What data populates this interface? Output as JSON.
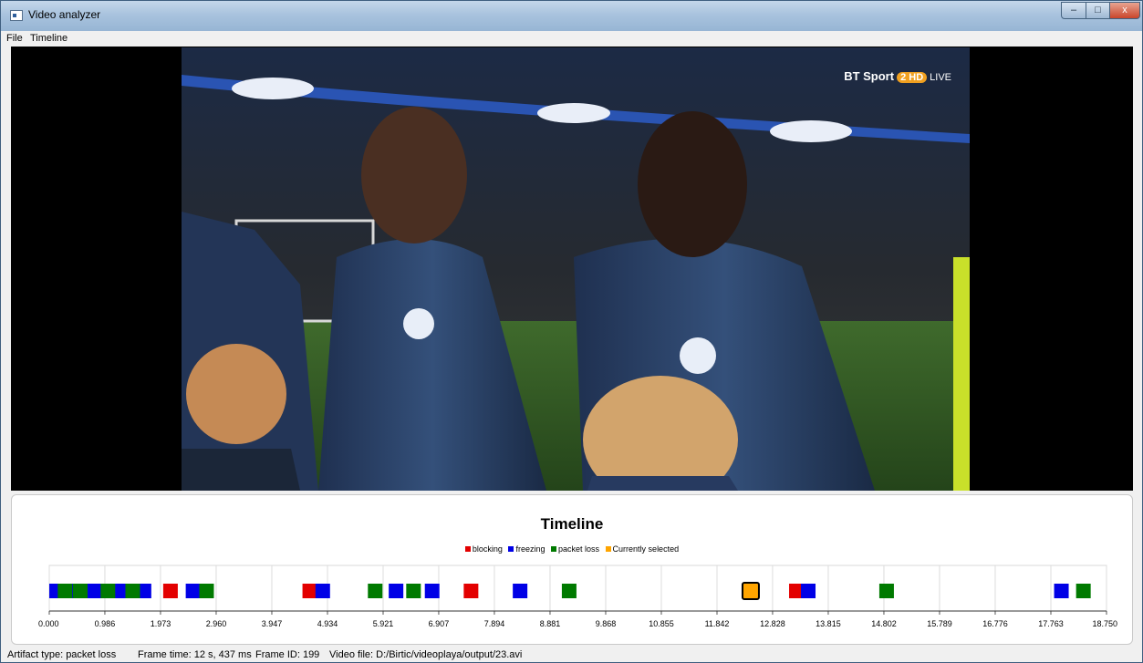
{
  "window": {
    "title": "Video analyzer",
    "minimize_glyph": "–",
    "maximize_glyph": "□",
    "close_glyph": "x"
  },
  "menu": {
    "file": "File",
    "timeline": "Timeline"
  },
  "video": {
    "logo_brand": "BT Sport",
    "logo_channel": "2 HD",
    "logo_live": "LIVE"
  },
  "timeline": {
    "title": "Timeline",
    "legend": [
      {
        "label": "blocking",
        "color": "#e30000"
      },
      {
        "label": "freezing",
        "color": "#0000e6"
      },
      {
        "label": "packet loss",
        "color": "#007a00"
      },
      {
        "label": "Currently selected",
        "color": "#ffa500"
      }
    ]
  },
  "chart_data": {
    "type": "scatter",
    "title": "Timeline",
    "xlim": [
      0.0,
      18.75
    ],
    "x_ticks": [
      "0.000",
      "0.986",
      "1.973",
      "2.960",
      "3.947",
      "4.934",
      "5.921",
      "6.907",
      "7.894",
      "8.881",
      "9.868",
      "10.855",
      "11.842",
      "12.828",
      "13.815",
      "14.802",
      "15.789",
      "16.776",
      "17.763",
      "18.750"
    ],
    "series": [
      {
        "name": "blocking",
        "color": "#e30000",
        "x": [
          0.66,
          2.15,
          4.62,
          7.48,
          13.25
        ]
      },
      {
        "name": "freezing",
        "color": "#0000e6",
        "x": [
          0.13,
          0.5,
          0.8,
          1.27,
          1.68,
          2.55,
          2.63,
          4.85,
          6.15,
          6.79,
          8.35,
          13.46,
          17.95
        ]
      },
      {
        "name": "packet loss",
        "color": "#007a00",
        "x": [
          0.28,
          0.55,
          1.04,
          1.48,
          2.79,
          5.78,
          6.46,
          9.22,
          14.85,
          18.34
        ]
      },
      {
        "name": "Currently selected",
        "color": "#ffa500",
        "x": [
          12.44
        ]
      }
    ]
  },
  "status": {
    "artifact": "Artifact type: packet loss",
    "frame_time": "Frame time: 12 s, 437 ms",
    "frame_id": "Frame ID: 199",
    "video_file": "Video file: D:/Birtic/videoplaya/output/23.avi"
  }
}
